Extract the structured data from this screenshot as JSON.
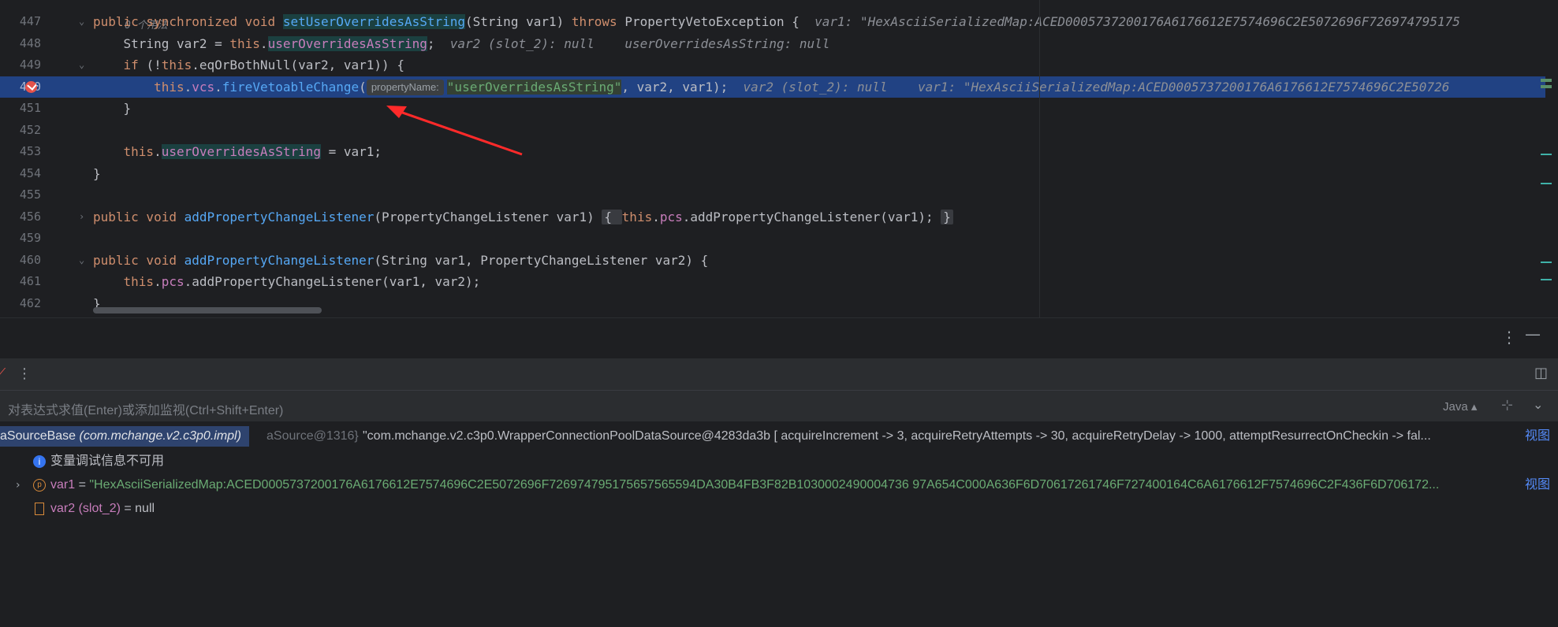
{
  "editor": {
    "lines": [
      {
        "num": "447",
        "tokens": [
          [
            "kw",
            "public synchronized void "
          ],
          [
            "fn mhl",
            "setUserOverridesAsString"
          ],
          [
            "",
            "(String var1) "
          ],
          [
            "kw",
            "throws "
          ],
          [
            "",
            "PropertyVetoException {  "
          ],
          [
            "inlay",
            "var1: \"HexAsciiSerializedMap:ACED0005737200176A6176612E7574696C2E5072696F726974795175"
          ]
        ]
      },
      {
        "num": "448",
        "tokens": [
          [
            "",
            "    String var2 = "
          ],
          [
            "kw",
            "this"
          ],
          [
            "",
            "."
          ],
          [
            "field mhl",
            "userOverridesAsString"
          ],
          [
            "",
            ";  "
          ],
          [
            "inlay",
            "var2 (slot_2): null    userOverridesAsString: null"
          ]
        ]
      },
      {
        "num": "449",
        "tokens": [
          [
            "",
            "    "
          ],
          [
            "kw",
            "if "
          ],
          [
            "",
            "(!"
          ],
          [
            "kw",
            "this"
          ],
          [
            "",
            ".eqOrBothNull(var2, var1)) {"
          ]
        ]
      },
      {
        "num": "450",
        "tokens": [
          [
            "",
            "        "
          ],
          [
            "kw",
            "this"
          ],
          [
            "",
            "."
          ],
          [
            "field",
            "vcs"
          ],
          [
            "",
            "."
          ],
          [
            "fn",
            "fireVetoableChange"
          ],
          [
            "",
            "("
          ],
          [
            "hint",
            "propertyName:"
          ],
          [
            "str shl",
            "\"userOverridesAsString\""
          ],
          [
            "",
            ", var2, var1);  "
          ],
          [
            "inlay",
            "var2 (slot_2): null    var1: \"HexAsciiSerializedMap:ACED0005737200176A6176612E7574696C2E50726"
          ]
        ]
      },
      {
        "num": "451",
        "tokens": [
          [
            "",
            "    }"
          ]
        ]
      },
      {
        "num": "452",
        "tokens": []
      },
      {
        "num": "453",
        "tokens": [
          [
            "",
            "    "
          ],
          [
            "kw",
            "this"
          ],
          [
            "",
            "."
          ],
          [
            "field mhl",
            "userOverridesAsString"
          ],
          [
            "",
            " = var1;"
          ]
        ]
      },
      {
        "num": "454",
        "tokens": [
          [
            "",
            "}"
          ]
        ]
      },
      {
        "num": "455",
        "tokens": []
      },
      {
        "num": "456",
        "tokens": [
          [
            "kw",
            "public void "
          ],
          [
            "fn",
            "addPropertyChangeListener"
          ],
          [
            "",
            "(PropertyChangeListener var1) "
          ],
          [
            "fold",
            "{ "
          ],
          [
            "kw",
            "this"
          ],
          [
            "",
            "."
          ],
          [
            "field",
            "pcs"
          ],
          [
            "",
            ".addPropertyChangeListener(var1); "
          ],
          [
            "fold",
            "}"
          ]
        ]
      },
      {
        "num": "459",
        "tokens": []
      },
      {
        "num": "460",
        "tokens": [
          [
            "kw",
            "public void "
          ],
          [
            "fn",
            "addPropertyChangeListener"
          ],
          [
            "",
            "(String var1, PropertyChangeListener var2) {"
          ]
        ]
      },
      {
        "num": "461",
        "tokens": [
          [
            "",
            "    "
          ],
          [
            "kw",
            "this"
          ],
          [
            "",
            "."
          ],
          [
            "field",
            "pcs"
          ],
          [
            "",
            ".addPropertyChangeListener(var1, var2);"
          ]
        ]
      },
      {
        "num": "462",
        "tokens": [
          [
            "",
            "}"
          ]
        ]
      }
    ],
    "usage_hint": "0 个用法"
  },
  "debugger": {
    "eval_placeholder": "对表达式求值(Enter)或添加监视(Ctrl+Shift+Enter)",
    "language": "Java",
    "frame_label": "aSourceBase",
    "frame_class": "(com.mchange.v2.c3p0.impl)",
    "frame_obj": "aSource@1316}",
    "frame_value": "\"com.mchange.v2.c3p0.WrapperConnectionPoolDataSource@4283da3b [ acquireIncrement -> 3, acquireRetryAttempts -> 30, acquireRetryDelay -> 1000, attemptResurrectOnCheckin -> fal...",
    "info_msg": "变量调试信息不可用",
    "var1_name": "var1",
    "var1_eq": " = ",
    "var1_value": "\"HexAsciiSerializedMap:ACED0005737200176A6176612E7574696C2E5072696F726974795175657565594DA30B4FB3F82B1030002490004736 97A654C000A636F6D70617261746F727400164C6A6176612F7574696C2F436F6D706172...",
    "var2_name": "var2 (slot_2)",
    "var2_value": " = null",
    "view_link": "视图"
  },
  "colors": {
    "accent": "#214283",
    "breakpoint": "#e5534b",
    "arrow": "#ff2a2a"
  }
}
